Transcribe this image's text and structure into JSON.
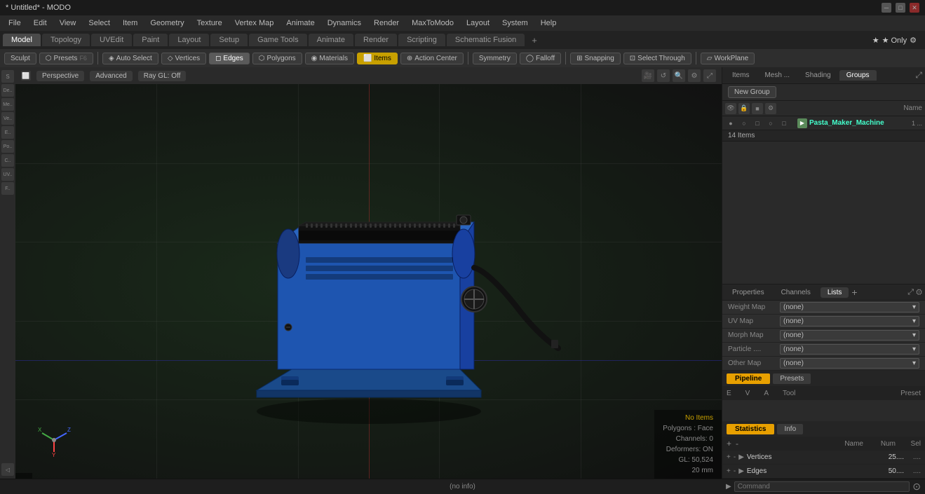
{
  "titleBar": {
    "title": "* Untitled* - MODO",
    "controls": [
      "minimize",
      "maximize",
      "close"
    ]
  },
  "menuBar": {
    "items": [
      "File",
      "Edit",
      "View",
      "Select",
      "Item",
      "Geometry",
      "Texture",
      "Vertex Map",
      "Animate",
      "Dynamics",
      "Render",
      "MaxToModo",
      "Layout",
      "System",
      "Help"
    ]
  },
  "modeTabs": {
    "tabs": [
      "Model",
      "Topology",
      "UVEdit",
      "Paint",
      "Layout",
      "Setup",
      "Game Tools",
      "Animate",
      "Render",
      "Scripting",
      "Schematic Fusion"
    ],
    "active": "Model",
    "schematic": "Schematic Fusion",
    "addBtn": "+",
    "starLabel": "★ Only",
    "settingsIcon": "⚙"
  },
  "toolBar": {
    "sculpt": "Sculpt",
    "presets": "Presets",
    "presetKey": "F6",
    "autoSelect": "Auto Select",
    "vertices": "Vertices",
    "edges": "Edges",
    "polygons": "Polygons",
    "materials": "Materials",
    "items": "Items",
    "actionCenter": "Action Center",
    "symmetry": "Symmetry",
    "falloff": "Falloff",
    "snapping": "Snapping",
    "selectThrough": "Select Through",
    "workPlane": "WorkPlane"
  },
  "viewport": {
    "perspective": "Perspective",
    "advanced": "Advanced",
    "rayGL": "Ray GL: Off",
    "controls": [
      "camera",
      "refresh",
      "zoom",
      "settings",
      "expand"
    ],
    "noItems": "No Items",
    "polygons": "Polygons : Face",
    "channels": "Channels: 0",
    "deformers": "Deformers: ON",
    "gl": "GL: 50,524",
    "measure": "20 mm",
    "info": "(no info)"
  },
  "rightPanel": {
    "tabs": [
      "Items",
      "Mesh ...",
      "Shading",
      "Groups"
    ],
    "activeTab": "Groups",
    "expandIcon": "⤢",
    "newGroup": "New Group",
    "listHeaders": {
      "name": "Name"
    },
    "listIcons": [
      "eye",
      "lock",
      "render",
      "settings"
    ],
    "sceneItem": {
      "label": "Pasta_Maker_Machine",
      "sub": "1 ...",
      "subCount": "14 Items"
    }
  },
  "lowerRightTabs": {
    "tabs": [
      "Properties",
      "Channels",
      "Lists"
    ],
    "activeTab": "Lists",
    "addBtn": "+",
    "expandIcon": "⤢",
    "settingsIcon": "⚙"
  },
  "mapRows": [
    {
      "label": "Weight Map",
      "value": "(none)"
    },
    {
      "label": "UV Map",
      "value": "(none)"
    },
    {
      "label": "Morph Map",
      "value": "(none)"
    },
    {
      "label": "Particle ...",
      "value": "(none)"
    },
    {
      "label": "Other Map",
      "value": "(none)"
    }
  ],
  "pipeline": {
    "pipelineLabel": "Pipeline",
    "presetsLabel": "Presets",
    "tableHeaders": [
      "E",
      "V",
      "A",
      "Tool",
      "Preset"
    ]
  },
  "statistics": {
    "statsLabel": "Statistics",
    "infoLabel": "Info",
    "controls": [
      "+",
      "-"
    ],
    "headers": [
      "Name",
      "Num",
      "Sel"
    ],
    "rows": [
      {
        "label": "Vertices",
        "num": "25....",
        "sel": "...."
      },
      {
        "label": "Edges",
        "num": "50....",
        "sel": "...."
      }
    ]
  },
  "bottomBar": {
    "info": "(no info)",
    "commandPlaceholder": "Command"
  },
  "leftSidebar": {
    "icons": [
      "S",
      "D",
      "M",
      "V",
      "E",
      "P",
      "C",
      "U",
      "F"
    ]
  }
}
